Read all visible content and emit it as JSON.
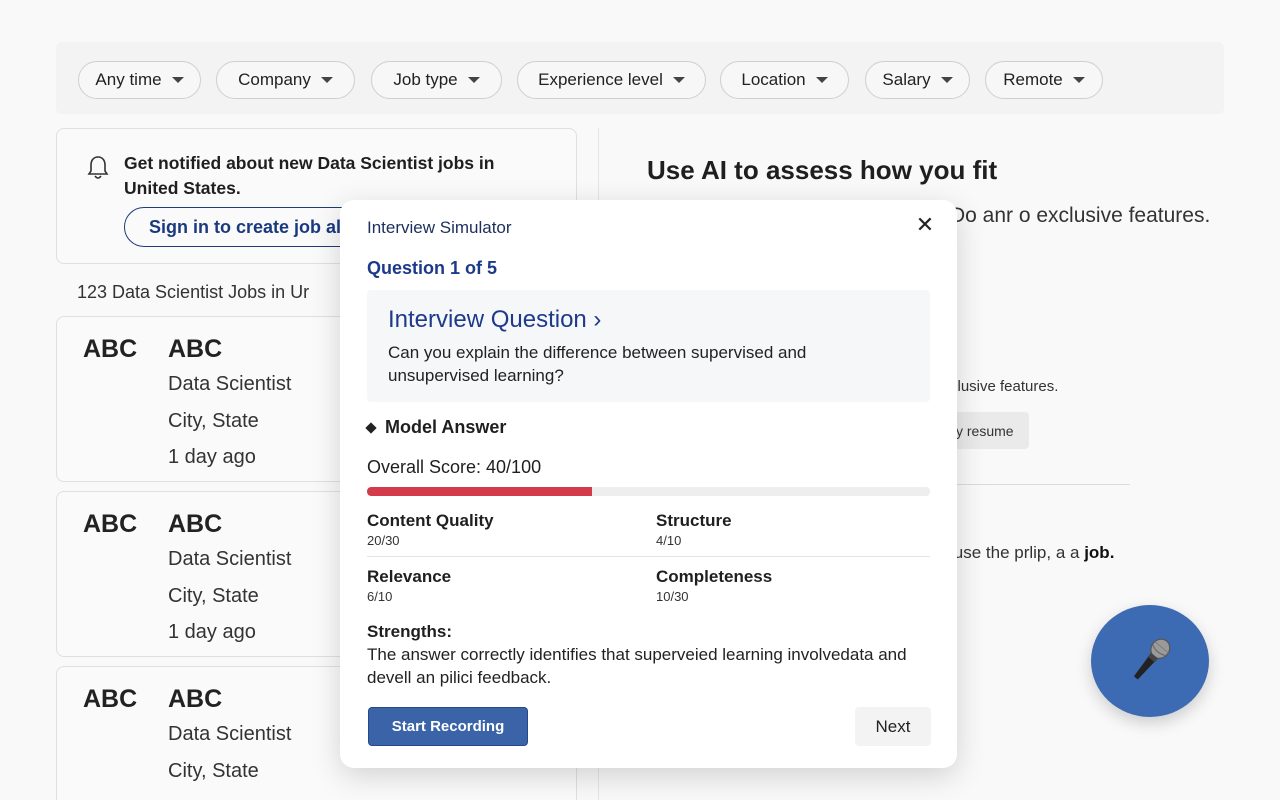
{
  "filters": [
    {
      "label": "Any time"
    },
    {
      "label": "Company"
    },
    {
      "label": "Job type"
    },
    {
      "label": "Experience level"
    },
    {
      "label": "Location"
    },
    {
      "label": "Salary"
    },
    {
      "label": "Remote"
    }
  ],
  "alert": {
    "text": "Get notified about new Data Scientist jobs in United States.",
    "button": "Sign in to create job al"
  },
  "results_count": "123 Data Scientist Jobs in Ur",
  "jobs": [
    {
      "logo": "ABC",
      "company": "ABC",
      "title": "Data Scientist",
      "location": "City, State",
      "posted": "1 day ago"
    },
    {
      "logo": "ABC",
      "company": "ABC",
      "title": "Data Scientist",
      "location": "City, State",
      "posted": "1 day ago"
    },
    {
      "logo": "ABC",
      "company": "ABC",
      "title": "Data Scientist",
      "location": "City, State",
      "posted": ""
    }
  ],
  "right_panel": {
    "title": "Use AI to assess how you fit",
    "subtitle": "Do anr o exclusive features.",
    "subtitle2": "clusive features.",
    "resume_button": "y resume",
    "subtitle3_prefix": "luse the prlip, a a ",
    "subtitle3_bold": "job."
  },
  "modal": {
    "title": "Interview Simulator",
    "close_icon": "close-icon",
    "question_progress": "Question 1 of 5",
    "question_heading": "Interview Question ›",
    "question_text": "Can you explain the difference between supervised and unsupervised learning?",
    "model_answer_label": "Model Answer",
    "overall_score_label": "Overall Score: 40/100",
    "overall_score_fraction": 0.4,
    "score_color": "#d33b4a",
    "metrics": [
      {
        "name": "Content Quality",
        "value": "20/30"
      },
      {
        "name": "Structure",
        "value": "4/10"
      },
      {
        "name": "Relevance",
        "value": "6/10"
      },
      {
        "name": "Completeness",
        "value": "10/30"
      }
    ],
    "strengths_label": "Strengths:",
    "strengths_text": "The answer  correctly identifies that superveied learning involvedata and devell an pilici feedback.",
    "record_button": "Start Recording",
    "next_button": "Next"
  },
  "fab": {
    "icon": "microphone-icon"
  },
  "colors": {
    "accent": "#3a63a8",
    "link": "#1d3a8a",
    "score": "#d33b4a"
  }
}
